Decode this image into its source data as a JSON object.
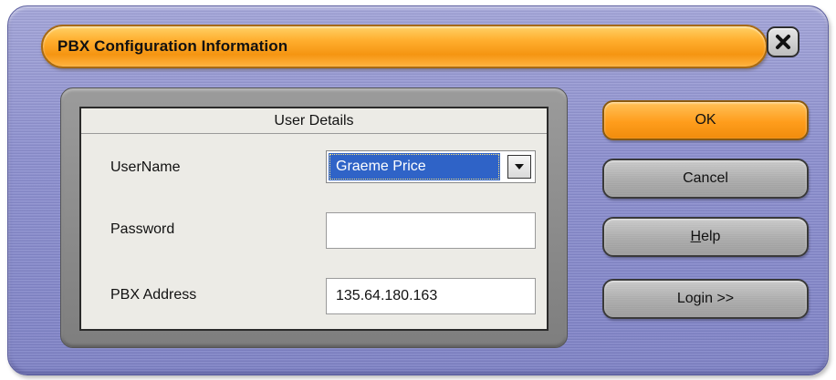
{
  "window": {
    "title": "PBX Configuration Information",
    "close_icon": "close-x-icon"
  },
  "group": {
    "header": "User Details"
  },
  "fields": {
    "username_label": "UserName",
    "username_value": "Graeme Price",
    "password_label": "Password",
    "password_value": "",
    "pbx_address_label": "PBX Address",
    "pbx_address_value": "135.64.180.163"
  },
  "buttons": {
    "ok": "OK",
    "cancel": "Cancel",
    "help_mnemonic": "H",
    "help_rest": "elp",
    "login": "Login >>"
  },
  "colors": {
    "title_accent": "#f59512",
    "primary_button": "#ff9d1c",
    "window_bg": "#8c8fcf",
    "selection": "#2f63c7"
  }
}
